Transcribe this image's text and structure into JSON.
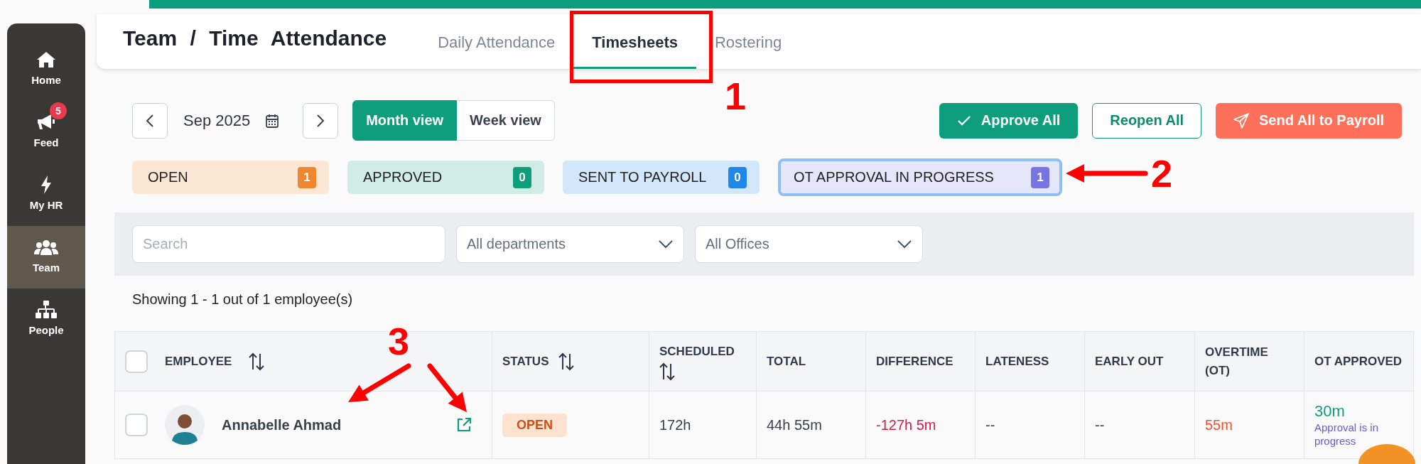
{
  "sidebar": {
    "items": [
      {
        "label": "Home",
        "kind": "home",
        "selected": false
      },
      {
        "label": "Feed",
        "kind": "megaphone",
        "badge": "5",
        "selected": false
      },
      {
        "label": "My HR",
        "kind": "bolt",
        "selected": false
      },
      {
        "label": "Team",
        "kind": "team",
        "selected": true
      },
      {
        "label": "People",
        "kind": "org",
        "selected": false
      }
    ]
  },
  "header": {
    "title": "Team / Time Attendance",
    "tabs": [
      {
        "label": "Daily Attendance",
        "selected": false
      },
      {
        "label": "Timesheets",
        "selected": true
      },
      {
        "label": "Rostering",
        "selected": false
      }
    ]
  },
  "toolbar": {
    "period": "Sep 2025",
    "views": [
      {
        "label": "Month view",
        "selected": true
      },
      {
        "label": "Week view",
        "selected": false
      }
    ],
    "actions": [
      {
        "label": "Approve All",
        "kind": "approve"
      },
      {
        "label": "Reopen All",
        "kind": "outline"
      },
      {
        "label": "Send All to Payroll",
        "kind": "payroll"
      }
    ]
  },
  "status_filters": [
    {
      "label": "OPEN",
      "count": "1",
      "color": "#f0862f",
      "selected": false
    },
    {
      "label": "APPROVED",
      "count": "0",
      "color": "#0e9e7c",
      "selected": false
    },
    {
      "label": "SENT TO PAYROLL",
      "count": "0",
      "color": "#1f87e8",
      "selected": false
    },
    {
      "label": "OT APPROVAL IN PROGRESS",
      "count": "1",
      "color": "#7676e2",
      "selected": true
    }
  ],
  "filters": {
    "search": {
      "placeholder": "Search"
    },
    "department": {
      "value": "All departments"
    },
    "office": {
      "value": "All Offices"
    }
  },
  "result_summary": "Showing 1 - 1 out of 1 employee(s)",
  "table": {
    "select_all_checked": false,
    "columns": [
      {
        "label": "EMPLOYEE",
        "sortable": true
      },
      {
        "label": "STATUS",
        "sortable": true
      },
      {
        "label": "SCHEDULED",
        "sortable": true
      },
      {
        "label": "TOTAL",
        "sortable": false
      },
      {
        "label": "DIFFERENCE",
        "sortable": false
      },
      {
        "label": "LATENESS",
        "sortable": false
      },
      {
        "label": "EARLY OUT",
        "sortable": false
      },
      {
        "label": "OVERTIME (OT)",
        "sortable": false
      },
      {
        "label": "OT APPROVED",
        "sortable": false
      }
    ],
    "rows": [
      {
        "checked": false,
        "employee": "Annabelle Ahmad",
        "status": "OPEN",
        "scheduled": "172h",
        "total": "44h 55m",
        "difference": "-127h 5m",
        "lateness": "--",
        "early_out": "--",
        "overtime": "55m",
        "ot_approved": "30m",
        "ot_approval_note": "Approval is in progress"
      }
    ]
  },
  "annotations": [
    {
      "kind": "box",
      "label": "1"
    },
    {
      "kind": "arrow",
      "label": "2"
    },
    {
      "kind": "double_arrow",
      "label": "3"
    }
  ]
}
